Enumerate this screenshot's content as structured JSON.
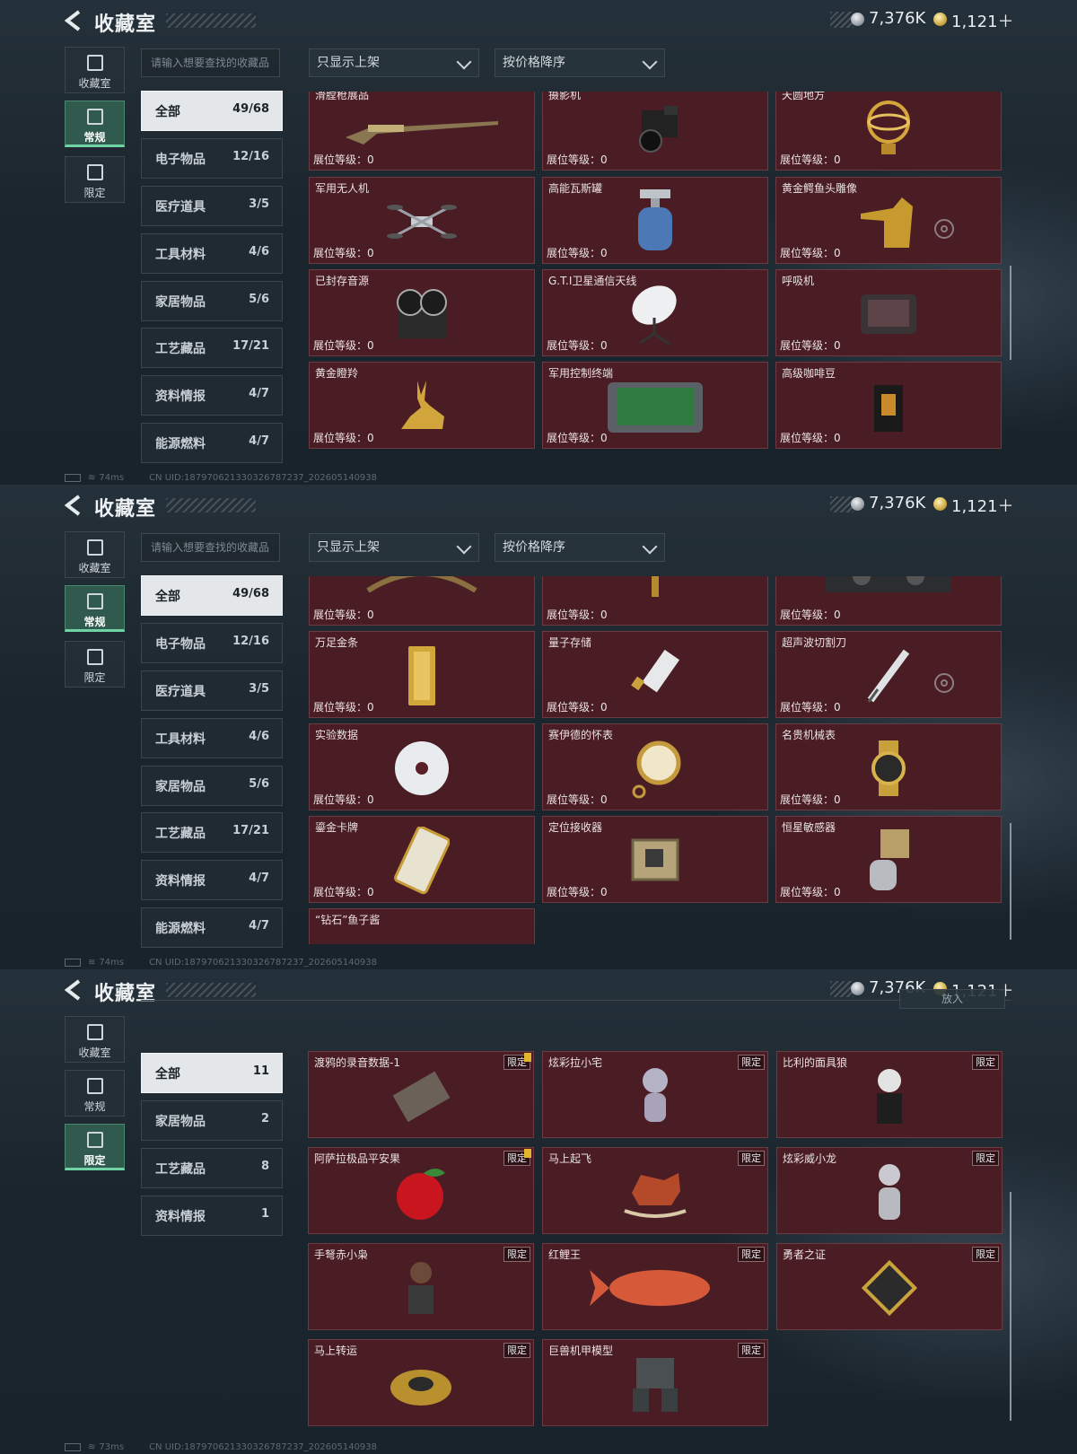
{
  "header": {
    "title": "收藏室",
    "silver": "7,376K",
    "gold": "1,121＋"
  },
  "nav": [
    "收藏室",
    "常规",
    "限定"
  ],
  "search_placeholder": "请输入想要查找的收藏品",
  "dropdowns": {
    "filter": "只显示上架",
    "sort": "按价格降序"
  },
  "level_label": "展位等级：0",
  "limit_label": "限定",
  "categories_regular": [
    {
      "name": "全部",
      "count": "49/68"
    },
    {
      "name": "电子物品",
      "count": "12/16"
    },
    {
      "name": "医疗道具",
      "count": "3/5"
    },
    {
      "name": "工具材料",
      "count": "4/6"
    },
    {
      "name": "家居物品",
      "count": "5/6"
    },
    {
      "name": "工艺藏品",
      "count": "17/21"
    },
    {
      "name": "资料情报",
      "count": "4/7"
    },
    {
      "name": "能源燃料",
      "count": "4/7"
    }
  ],
  "categories_limited": [
    {
      "name": "全部",
      "count": "11"
    },
    {
      "name": "家居物品",
      "count": "2"
    },
    {
      "name": "工艺藏品",
      "count": "8"
    },
    {
      "name": "资料情报",
      "count": "1"
    }
  ],
  "panel1_items": [
    "滑膛枪展品",
    "摄影机",
    "天圆地方",
    "军用无人机",
    "高能瓦斯罐",
    "黄金鳄鱼头雕像",
    "已封存音源",
    "G.T.I卫星通信天线",
    "呼吸机",
    "黄金瞪羚",
    "军用控制终端",
    "高级咖啡豆"
  ],
  "panel2_items": [
    "万足金条",
    "量子存储",
    "超声波切割刀",
    "实验数据",
    "赛伊德的怀表",
    "名贵机械表",
    "鎏金卡牌",
    "定位接收器",
    "恒星敏感器",
    "“钻石”鱼子酱"
  ],
  "panel3_items": [
    "渡鸦的录音数据-1",
    "炫彩拉小宅",
    "比利的面具狼",
    "阿萨拉极品平安果",
    "马上起飞",
    "炫彩威小龙",
    "手弩赤小枭",
    "红鲤王",
    "勇者之证",
    "马上转运",
    "巨兽机甲模型"
  ],
  "panel3_place_button": "放入",
  "footers": [
    {
      "ping": "74ms",
      "uid": "CN UID:1879706213303267872​37_202605140938"
    },
    {
      "ping": "74ms",
      "uid": "CN UID:1879706213303267872​37_202605140938"
    },
    {
      "ping": "73ms",
      "uid": "CN UID:1879706213303267872​37_202605140938"
    }
  ]
}
